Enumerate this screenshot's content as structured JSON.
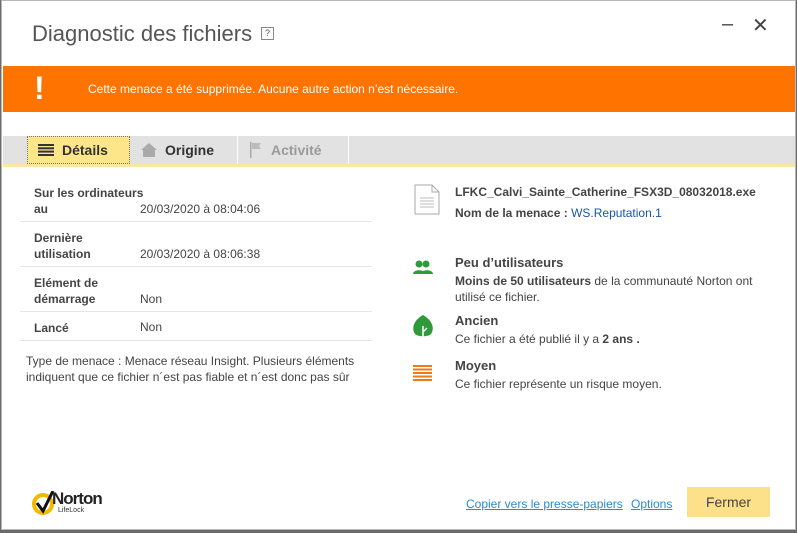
{
  "window": {
    "title": "Diagnostic des fichiers",
    "help": "?",
    "minimize": "–",
    "close": "✕"
  },
  "banner": {
    "icon": "!",
    "message": "Cette menace a été supprimée. Aucune autre action n’est nécessaire.",
    "color": "#ff7300"
  },
  "tabs": [
    {
      "label": "Détails",
      "icon": "list-icon",
      "active": true
    },
    {
      "label": "Origine",
      "icon": "home-icon"
    },
    {
      "label": "Activité",
      "icon": "flag-icon",
      "disabled": true
    }
  ],
  "details": {
    "rows": [
      {
        "label1": "Sur les ordinateurs",
        "label2": "au",
        "value": "20/03/2020 à 08:04:06"
      },
      {
        "label1": "Dernière",
        "label2": "utilisation",
        "value": "20/03/2020 à 08:06:38"
      },
      {
        "label1": "Elément de",
        "label2": "démarrage",
        "value": "Non"
      },
      {
        "label1": "",
        "label2": "Lancé",
        "value": "Non"
      }
    ],
    "description": "Type de menace : Menace réseau Insight. Plusieurs éléments indiquent que ce fichier n´est pas fiable et n´est donc pas sûr"
  },
  "file": {
    "name": "LFKC_Calvi_Sainte_Catherine_FSX3D_08032018.exe",
    "threat_label": "Nom de la menace :",
    "threat_name": "WS.Reputation.1"
  },
  "insights": [
    {
      "icon": "users-icon",
      "title": "Peu d’utilisateurs",
      "bold": "Moins de 50 utilisateurs",
      "text": " de la communauté Norton ont utilisé ce fichier."
    },
    {
      "icon": "leaf-icon",
      "title": "Ancien",
      "text": "Ce fichier a été publié il y a ",
      "bold": "2 ans ."
    },
    {
      "icon": "risk-medium-icon",
      "title": "Moyen",
      "text": "Ce fichier représente un risque moyen."
    }
  ],
  "footer": {
    "brand": "Norton",
    "sub": "LifeLock",
    "copy": "Copier vers le presse-papiers",
    "options": "Options",
    "close": "Fermer"
  }
}
